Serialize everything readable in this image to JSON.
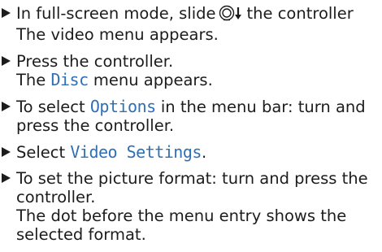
{
  "steps": [
    {
      "part1": "In full-screen mode, slide",
      "part2": "the controller",
      "result": "The video menu appears."
    },
    {
      "text": "Press the controller.",
      "result_pre": "The ",
      "result_term": "Disc",
      "result_post": " menu appears."
    },
    {
      "pre": "To select ",
      "term": "Options",
      "post": " in the menu bar: turn and",
      "line2": "press the controller."
    },
    {
      "pre": "Select ",
      "term": "Video Settings",
      "post": "."
    },
    {
      "line1": "To set the picture format: turn and press the",
      "line2": "controller.",
      "line3": "The dot before the menu entry shows the",
      "line4": "selected format."
    }
  ],
  "icons": {
    "bullet": "triangle-right-bullet-icon",
    "controller": "controller-slide-down-icon"
  },
  "colors": {
    "text": "#1c1c1c",
    "menu_term": "#2f6fb6"
  }
}
